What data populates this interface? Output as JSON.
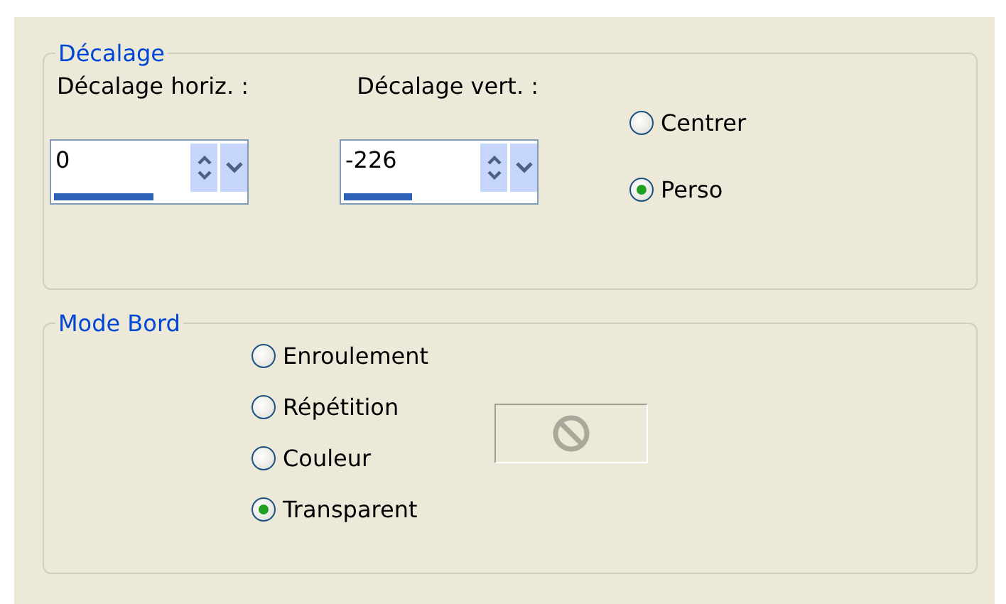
{
  "offset_group": {
    "title": "Décalage",
    "spinners": [
      {
        "label": "Décalage horiz. :",
        "value": "0",
        "level": 0.52
      },
      {
        "label": "Décalage vert.  :",
        "value": "-226",
        "level": 0.36
      }
    ],
    "position_options": [
      {
        "label": "Centrer",
        "selected": false
      },
      {
        "label": "Perso",
        "selected": true
      }
    ]
  },
  "edge_group": {
    "title": "Mode Bord",
    "options": [
      {
        "label": "Enroulement",
        "selected": false
      },
      {
        "label": "Répétition",
        "selected": false
      },
      {
        "label": "Couleur",
        "selected": false
      },
      {
        "label": "Transparent",
        "selected": true
      }
    ],
    "color_button": {
      "disabled": true
    }
  }
}
